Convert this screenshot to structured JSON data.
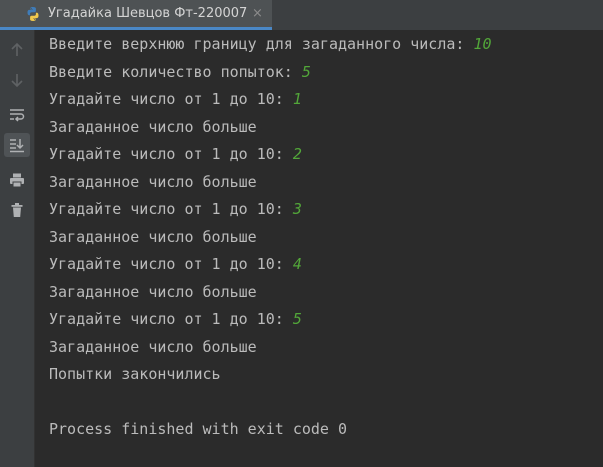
{
  "tab": {
    "title": "Угадайка Шевцов Фт-220007",
    "close": "×"
  },
  "toolbar": {
    "buttons": [
      "rerun-up-icon",
      "down-arrow-icon",
      "soft-wrap-icon",
      "scroll-to-end-icon",
      "print-icon",
      "trash-icon"
    ]
  },
  "console": {
    "lines": [
      {
        "text": "Введите верхнюю границу для загаданного числа: ",
        "input": "10"
      },
      {
        "text": "Введите количество попыток: ",
        "input": "5"
      },
      {
        "text": "Угадайте число от 1 до 10: ",
        "input": "1"
      },
      {
        "text": "Загаданное число больше",
        "input": ""
      },
      {
        "text": "Угадайте число от 1 до 10: ",
        "input": "2"
      },
      {
        "text": "Загаданное число больше",
        "input": ""
      },
      {
        "text": "Угадайте число от 1 до 10: ",
        "input": "3"
      },
      {
        "text": "Загаданное число больше",
        "input": ""
      },
      {
        "text": "Угадайте число от 1 до 10: ",
        "input": "4"
      },
      {
        "text": "Загаданное число больше",
        "input": ""
      },
      {
        "text": "Угадайте число от 1 до 10: ",
        "input": "5"
      },
      {
        "text": "Загаданное число больше",
        "input": ""
      },
      {
        "text": "Попытки закончились",
        "input": ""
      },
      {
        "text": "",
        "input": ""
      },
      {
        "text": "Process finished with exit code 0",
        "input": ""
      }
    ]
  },
  "colors": {
    "background": "#2b2b2b",
    "text": "#bbbbbb",
    "user_input": "#52a639",
    "tab_underline": "#4a88c7"
  }
}
